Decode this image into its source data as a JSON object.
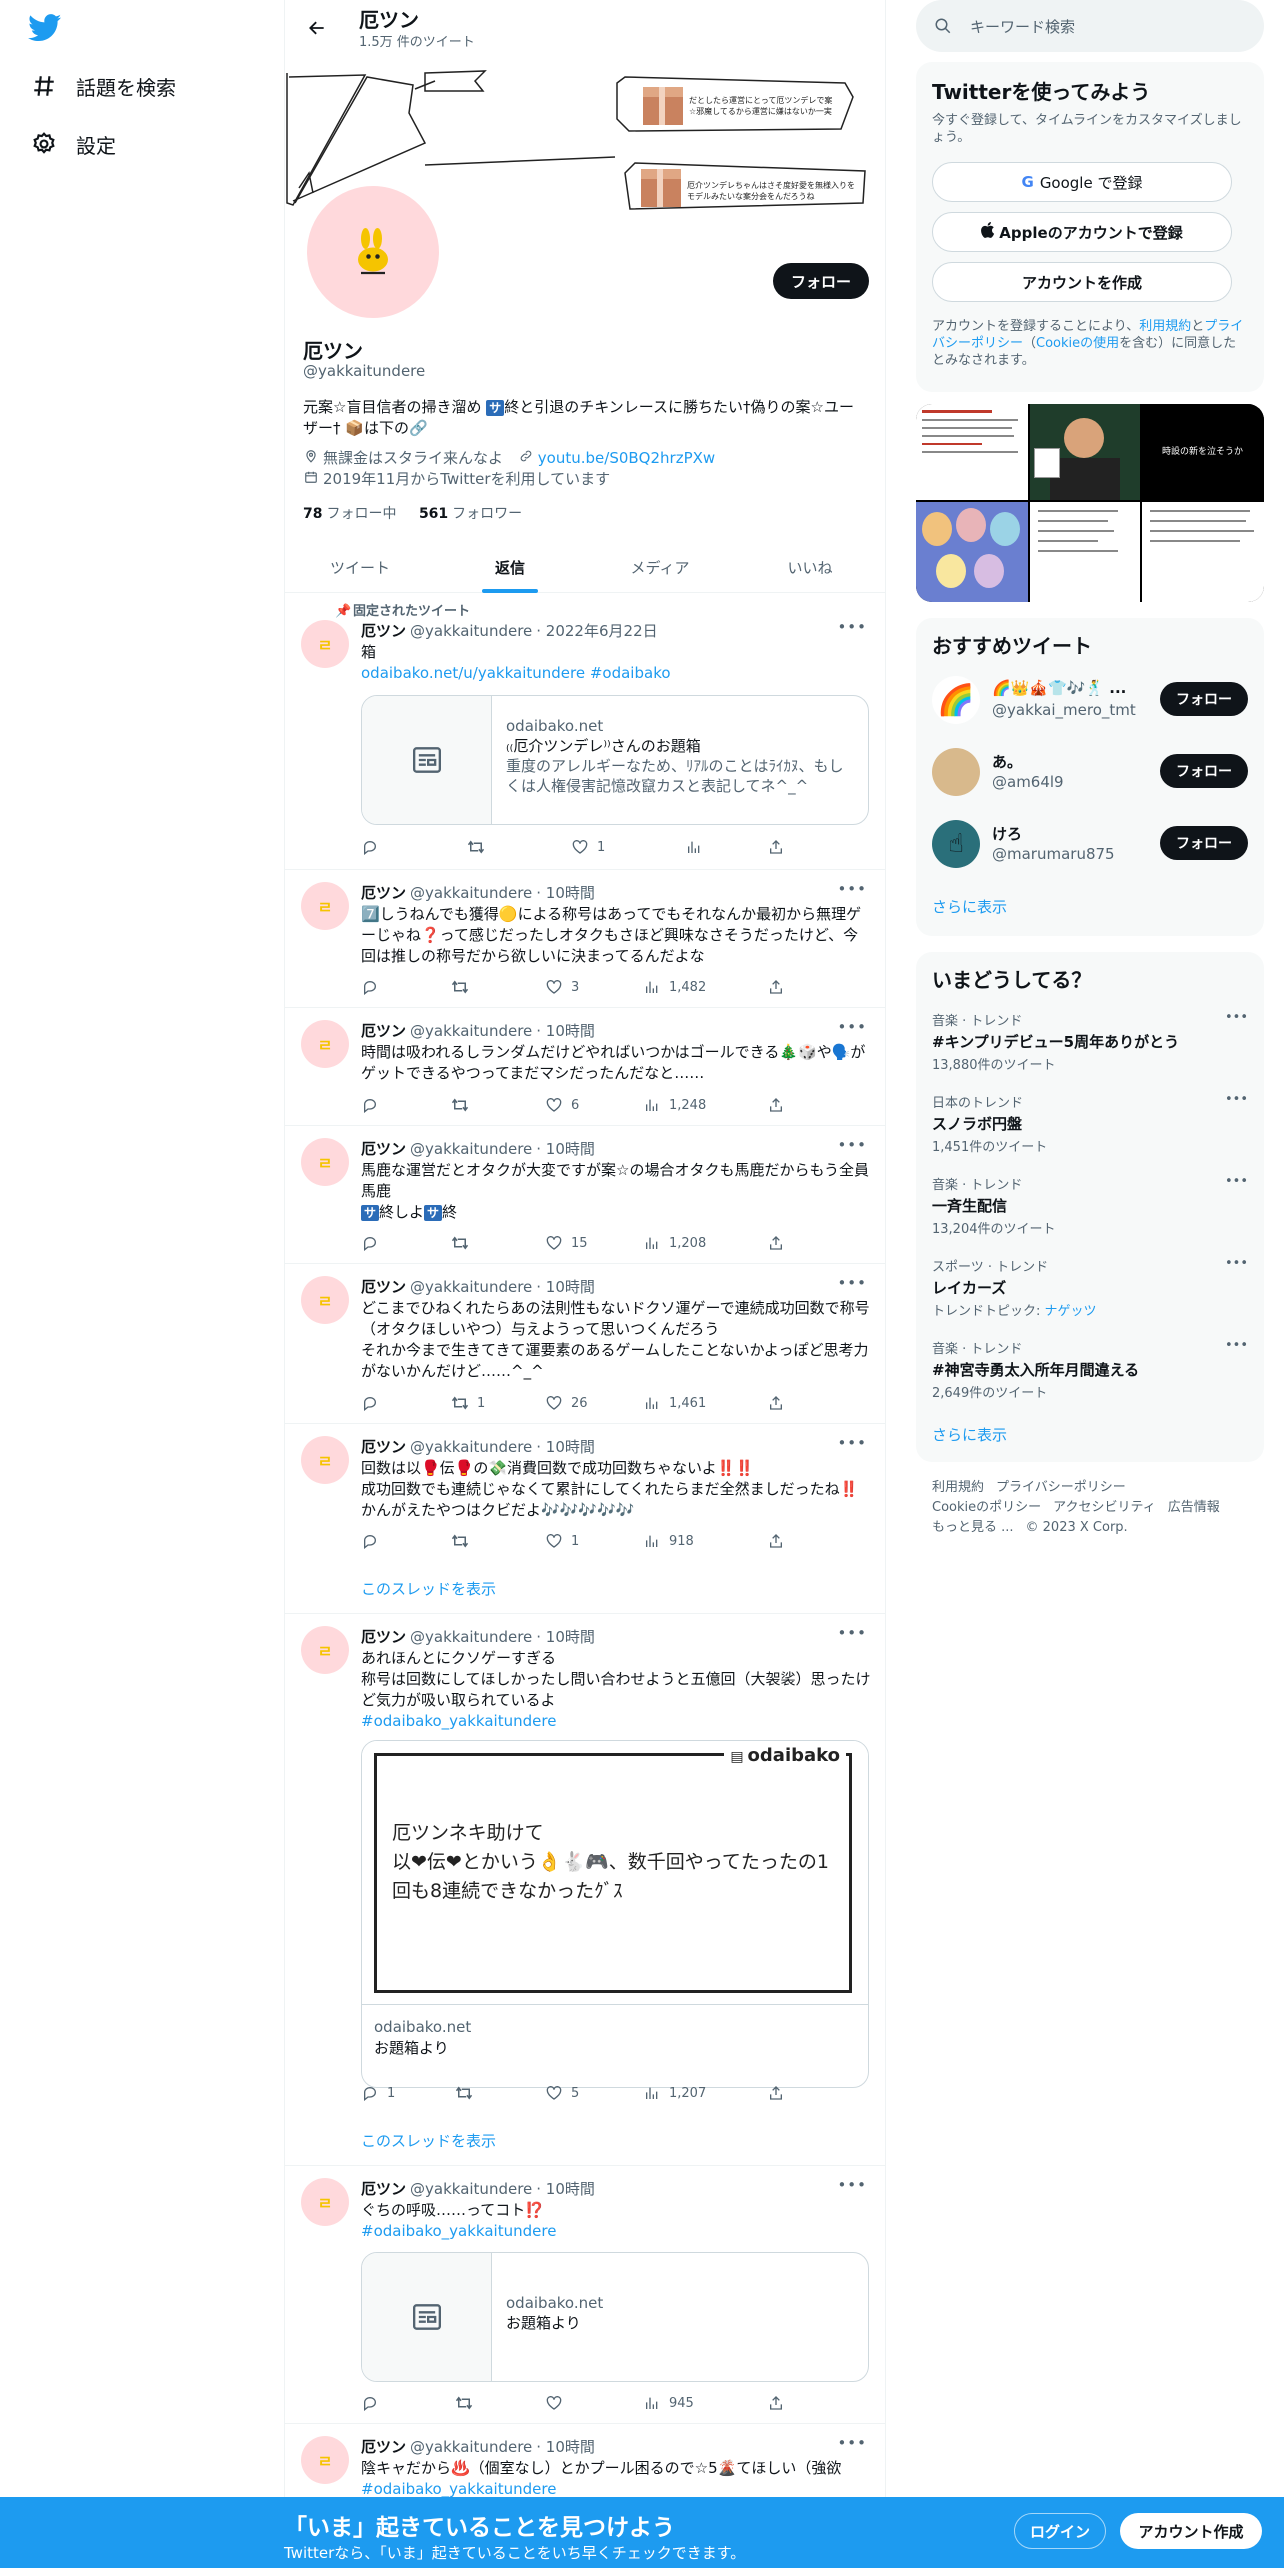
{
  "colors": {
    "accent": "#1d9bf0",
    "text": "#0f1419",
    "muted": "#536471",
    "avatar_bg": "#ffd9dc"
  },
  "nav": {
    "explore": "話題を検索",
    "settings": "設定"
  },
  "profile": {
    "header_name": "厄ツン",
    "tweet_count": "1.5万 件のツイート",
    "follow": "フォロー",
    "name": "厄ツン",
    "handle": "@yakkaitundere",
    "bio_1": "元案☆盲目信者の掃き溜め ",
    "bio_badge_1": "サ",
    "bio_2": "終と引退のチキンレースに勝ちたい†偽りの案☆ユーザー† 📦は下の🔗",
    "location": "無課金はスタライ来んなよ",
    "link": "youtu.be/S0BQ2hrzPXw",
    "joined": "2019年11月からTwitterを利用しています",
    "following_count": "78",
    "following_label": "フォロー中",
    "followers_count": "561",
    "followers_label": "フォロワー",
    "banner_note_1": "だとしたら運営にとって厄ツンデレで案☆邪魔してるから運営に嫌はないか一実",
    "banner_note_2": "厄介ツンデレちゃんはさそ度好愛を無様入りをモデルみたいな案分会をんだろうね"
  },
  "tabs": [
    "ツイート",
    "返信",
    "メディア",
    "いいね"
  ],
  "pinned_label": "固定されたツイート",
  "tweets": [
    {
      "name": "厄ツン",
      "handle": "@yakkaitundere",
      "time": "· 2022年6月22日",
      "text": "箱",
      "link_line": "odaibako.net/u/yakkaitundere #odaibako",
      "card": {
        "domain": "odaibako.net",
        "title": "₍₍厄介ツンデレ⁾⁾さんのお題箱",
        "desc": "重度のアレルギーなため、ﾘｱﾙのことはﾗｲｶﾇ、もしくは人権侵害記憶改竄カスと表記してネ^_^"
      },
      "reply": "",
      "retweet": "",
      "like": "1",
      "views": ""
    },
    {
      "name": "厄ツン",
      "handle": "@yakkaitundere",
      "time": "· 10時間",
      "text": "7️⃣しうねんでも獲得🟡による称号はあってでもそれなんか最初から無理ゲーじゃね❓って感じだったしオタクもさほど興味なさそうだったけど、今回は推しの称号だから欲しいに決まってるんだよな",
      "reply": "",
      "retweet": "",
      "like": "3",
      "views": "1,482"
    },
    {
      "name": "厄ツン",
      "handle": "@yakkaitundere",
      "time": "· 10時間",
      "text": "時間は吸われるしランダムだけどやればいつかはゴールできる🎄🎲や🗣️がゲットできるやつってまだマシだったんだなと……",
      "reply": "",
      "retweet": "",
      "like": "6",
      "views": "1,248"
    },
    {
      "name": "厄ツン",
      "handle": "@yakkaitundere",
      "time": "· 10時間",
      "text_1": "馬鹿な運営だとオタクが大変ですが案☆の場合オタクも馬鹿だからもう全員馬鹿",
      "badge_a": "サ",
      "text_2": "終しよ",
      "badge_b": "サ",
      "text_3": "終",
      "reply": "",
      "retweet": "",
      "like": "15",
      "views": "1,208"
    },
    {
      "name": "厄ツン",
      "handle": "@yakkaitundere",
      "time": "· 10時間",
      "text": "どこまでひねくれたらあの法則性もないドクソ運ゲーで連続成功回数で称号（オタクほしいやつ）与えようって思いつくんだろう\nそれか今まで生きてきて運要素のあるゲームしたことないかよっぽど思考力がないかんだけど……^_^",
      "reply": "",
      "retweet": "1",
      "like": "26",
      "views": "1,461"
    },
    {
      "name": "厄ツン",
      "handle": "@yakkaitundere",
      "time": "· 10時間",
      "text": "回数は以🥊伝🥊の💸消費回数で成功回数ちゃないよ‼️‼️\n成功回数でも連続じゃなくて累計にしてくれたらまだ全然ましだったね‼️かんがえたやつはクビだよ🎶🎶🎶🎶🎶",
      "reply": "",
      "retweet": "",
      "like": "1",
      "views": "918",
      "thread": "このスレッドを表示"
    },
    {
      "name": "厄ツン",
      "handle": "@yakkaitundere",
      "time": "· 10時間",
      "text": "あれほんとにクソゲーすぎる\n称号は回数にしてほしかったし問い合わせようと五億回（大袈裟）思ったけど気力が吸い取られているよ",
      "hashtag": "#odaibako_yakkaitundere",
      "card": {
        "brand": "odaibako",
        "image_text": "厄ツンネキ助けて\n以❤伝❤とかいう👌🐇🎮、数千回やってたったの1回も8連続できなかったｸﾞｽ",
        "domain": "odaibako.net",
        "title": "お題箱より"
      },
      "reply": "1",
      "retweet": "",
      "like": "5",
      "views": "1,207",
      "thread": "このスレッドを表示"
    },
    {
      "name": "厄ツン",
      "handle": "@yakkaitundere",
      "time": "· 10時間",
      "text": "ぐちの呼吸……ってコト⁉️",
      "hashtag": "#odaibako_yakkaitundere",
      "card": {
        "domain": "odaibako.net",
        "title": "お題箱より"
      },
      "reply": "",
      "retweet": "",
      "like": "",
      "views": "945"
    },
    {
      "name": "厄ツン",
      "handle": "@yakkaitundere",
      "time": "· 10時間",
      "text": "陰キャだから♨️（個室なし）とかプール困るので☆5🌋てほしい（強欲",
      "hashtag": "#odaibako_yakkaitundere"
    }
  ],
  "right": {
    "search_placeholder": "キーワード検索",
    "signup_title": "Twitterを使ってみよう",
    "signup_desc": "今すぐ登録して、タイムラインをカスタマイズしましょう。",
    "google_btn": "Google で登録",
    "apple_btn": "Appleのアカウントで登録",
    "create_btn": "アカウントを作成",
    "terms_1": "アカウントを登録することにより、",
    "terms_link_1": "利用規約",
    "terms_2": "と",
    "terms_link_2": "プライバシーポリシー",
    "terms_3": "（",
    "terms_link_3": "Cookieの使用",
    "terms_4": "を含む）に同意したとみなされます。",
    "media_caption": "時設の新を泣そうか",
    "rec_title": "おすすめツイート",
    "rec_users": [
      {
        "name": "🌈👑🎪👕🎶🕺 ...",
        "handle": "@yakkai_mero_tmt",
        "follow": "フォロー"
      },
      {
        "name": "あ。",
        "handle": "@am64l9",
        "follow": "フォロー"
      },
      {
        "name": "けろ",
        "handle": "@marumaru875",
        "follow": "フォロー"
      }
    ],
    "show_more": "さらに表示",
    "trends_title": "いまどうしてる？",
    "trends": [
      {
        "cat": "音楽 · トレンド",
        "name": "#キンプリデビュー5周年ありがとう",
        "count": "13,880件のツイート"
      },
      {
        "cat": "日本のトレンド",
        "name": "スノラボ円盤",
        "count": "1,451件のツイート"
      },
      {
        "cat": "音楽 · トレンド",
        "name": "一斉生配信",
        "count": "13,204件のツイート"
      },
      {
        "cat": "スポーツ · トレンド",
        "name": "レイカーズ",
        "count_prefix": "トレンドトピック: ",
        "count_link": "ナゲッツ"
      },
      {
        "cat": "音楽 · トレンド",
        "name": "#神宮寺勇太入所年月間違える",
        "count": "2,649件のツイート"
      }
    ],
    "trends_more": "さらに表示",
    "footer": [
      "利用規約",
      "プライバシーポリシー",
      "Cookieのポリシー",
      "アクセシビリティ",
      "広告情報",
      "もっと見る ...",
      "© 2023 X Corp."
    ]
  },
  "bottom": {
    "title": "「いま」起きていることを見つけよう",
    "subtitle": "Twitterなら、「いま」起きていることをいち早くチェックできます。",
    "login": "ログイン",
    "signup": "アカウント作成"
  }
}
